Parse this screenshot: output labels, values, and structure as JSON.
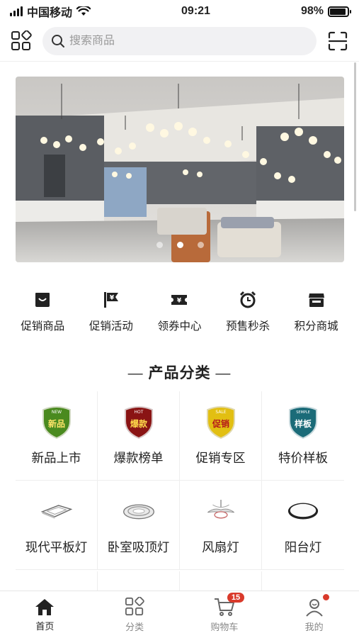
{
  "status_bar": {
    "carrier": "中国移动",
    "time": "09:21",
    "battery": "98%"
  },
  "search": {
    "placeholder": "搜索商品"
  },
  "banner": {
    "slide_count": 3,
    "active_slide": 2
  },
  "quick_menu": [
    {
      "label": "促销商品",
      "icon": "shopping-bag-icon"
    },
    {
      "label": "促销活动",
      "icon": "price-flag-icon"
    },
    {
      "label": "领券中心",
      "icon": "coupon-ticket-icon"
    },
    {
      "label": "预售秒杀",
      "icon": "alarm-clock-icon"
    },
    {
      "label": "积分商城",
      "icon": "store-icon"
    }
  ],
  "section": {
    "title": "产品分类",
    "dash": "—"
  },
  "categories": [
    {
      "label": "新品上市",
      "badge": "新品",
      "badge_top": "NEW",
      "color": "#4a8a1f"
    },
    {
      "label": "爆款榜单",
      "badge": "爆款",
      "badge_top": "HOT",
      "color": "#8a1414"
    },
    {
      "label": "促销专区",
      "badge": "促销",
      "badge_top": "SALE",
      "color": "#c9a400"
    },
    {
      "label": "特价样板",
      "badge": "样板",
      "badge_top": "SEMPLE",
      "color": "#1b6b78"
    },
    {
      "label": "现代平板灯",
      "icon": "panel-lamp-icon"
    },
    {
      "label": "卧室吸顶灯",
      "icon": "ceiling-lamp-icon"
    },
    {
      "label": "风扇灯",
      "icon": "fan-lamp-icon"
    },
    {
      "label": "阳台灯",
      "icon": "round-lamp-icon"
    }
  ],
  "tabbar": [
    {
      "label": "首页",
      "active": true
    },
    {
      "label": "分类"
    },
    {
      "label": "购物车",
      "badge": "15"
    },
    {
      "label": "我的",
      "dot": true
    }
  ],
  "colors": {
    "accent": "#d93a2b",
    "text": "#222222",
    "muted": "#888888"
  }
}
